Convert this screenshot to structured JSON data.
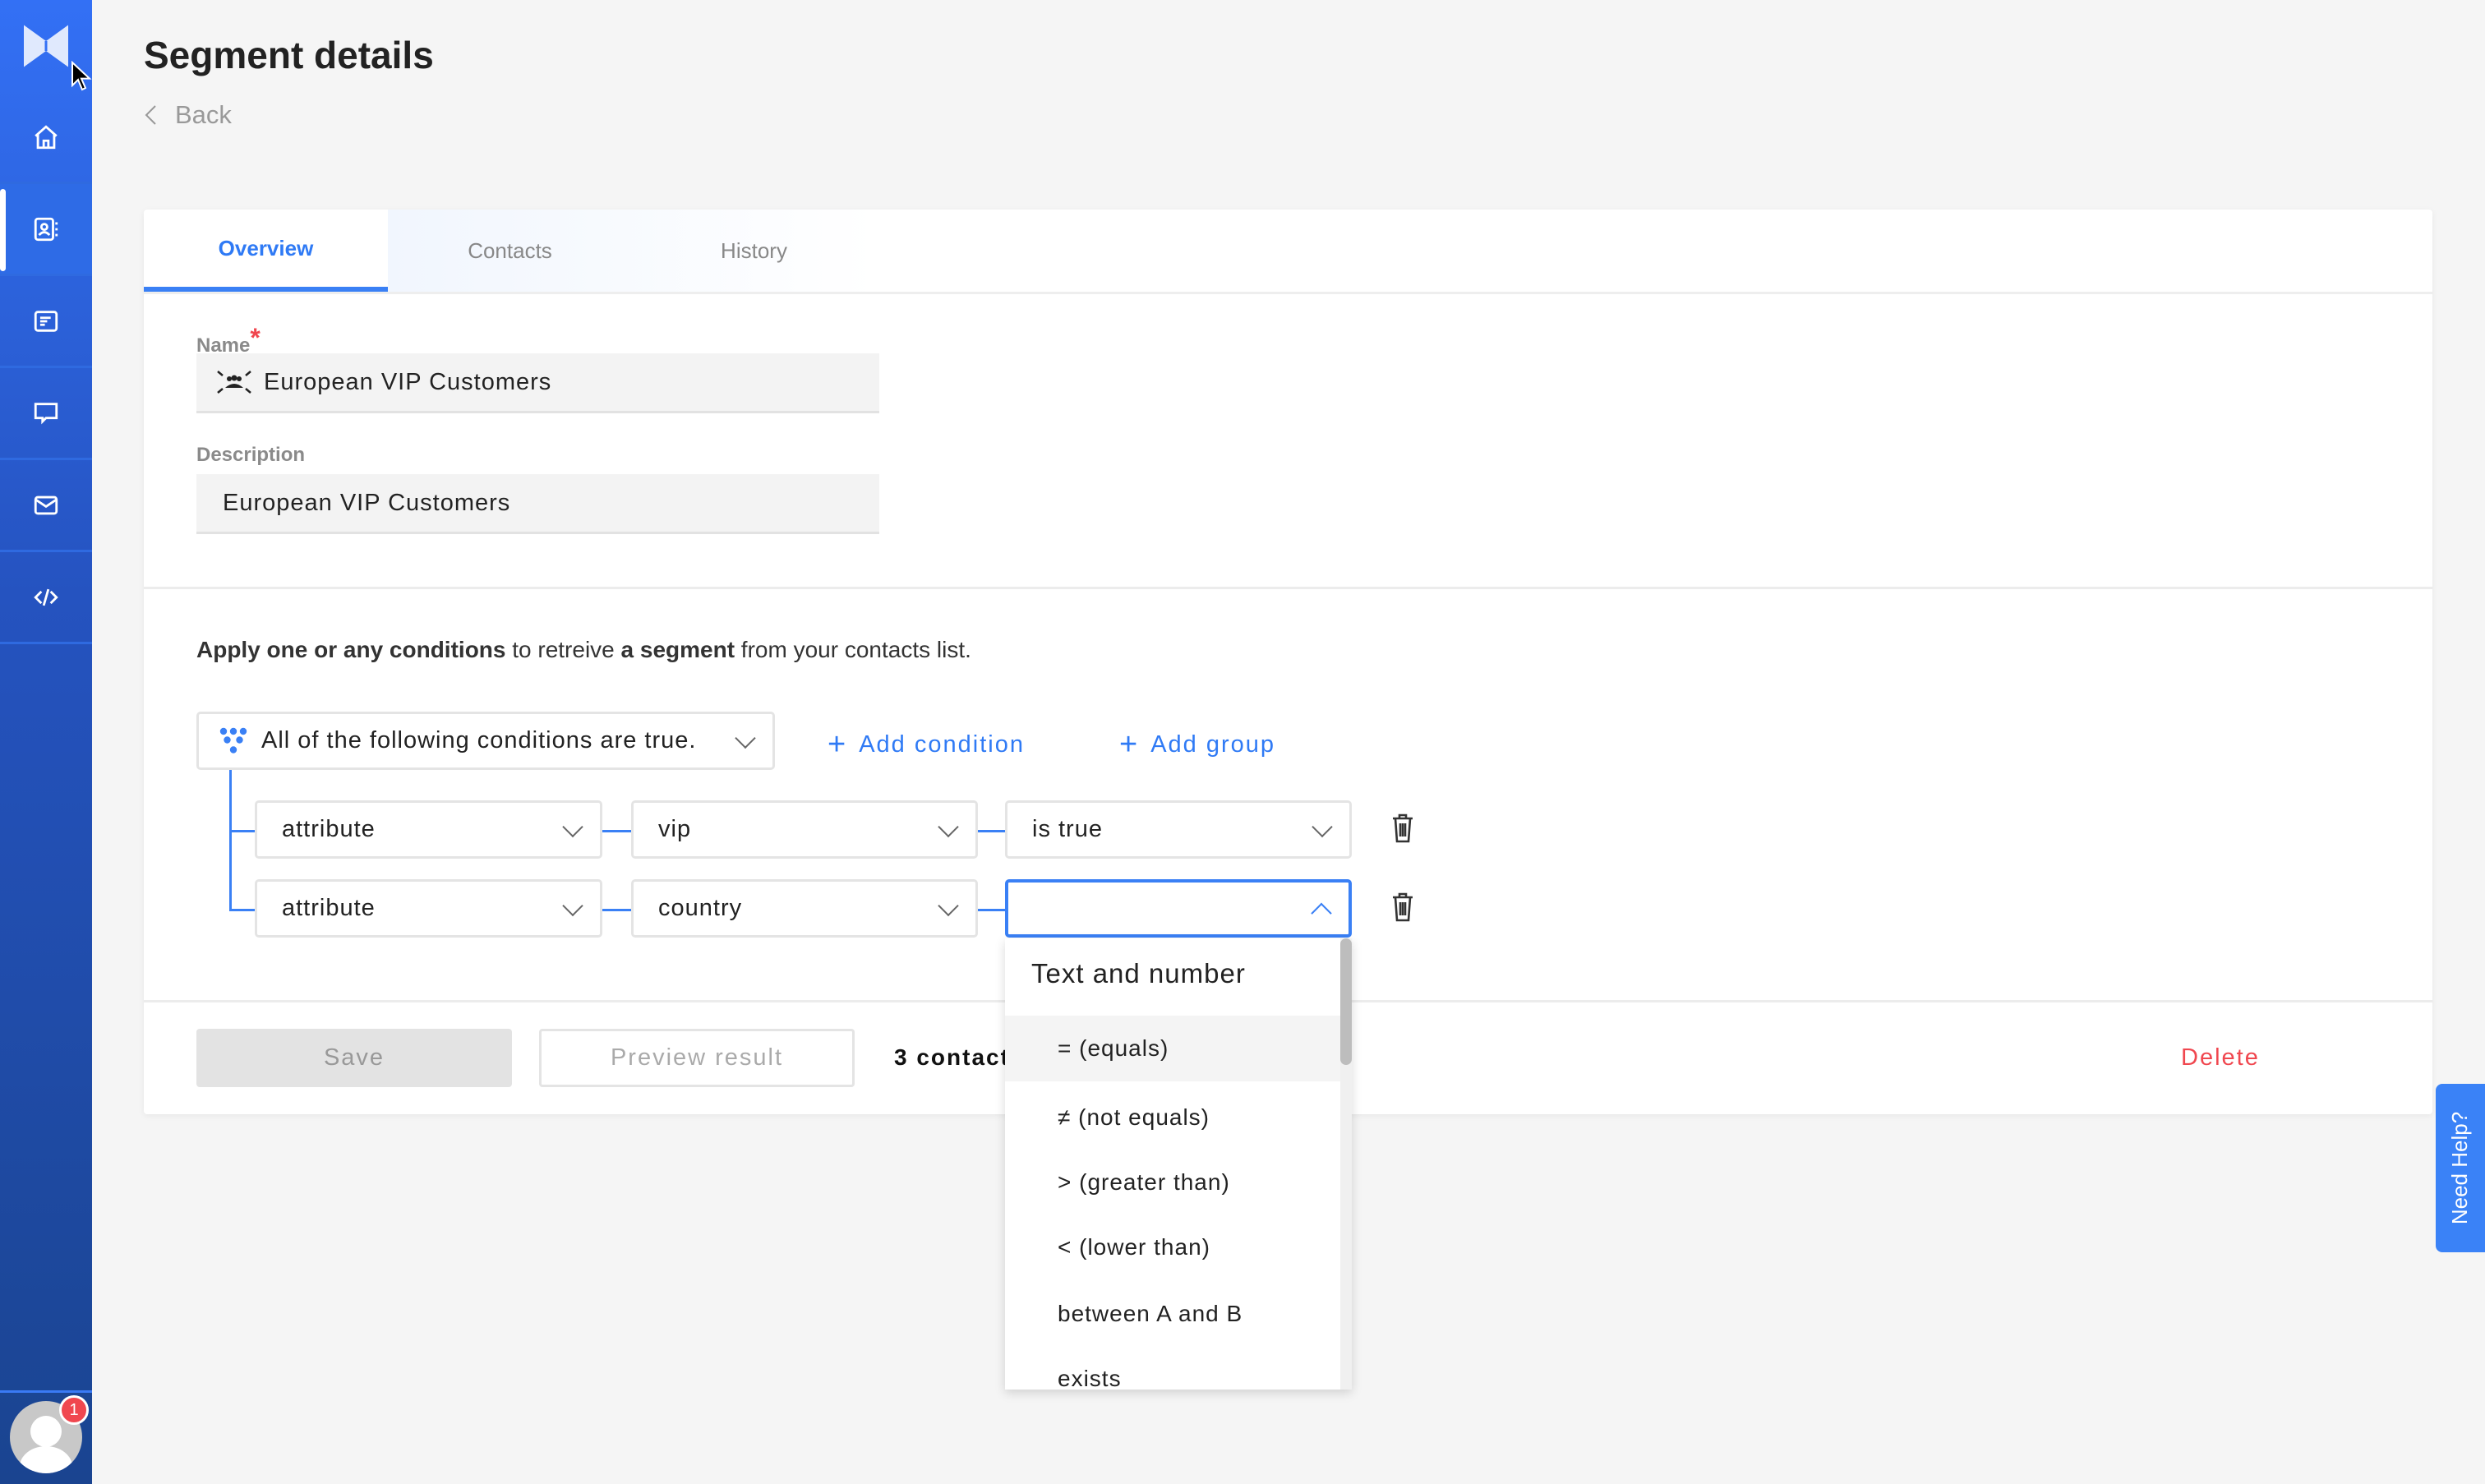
{
  "colors": {
    "accent": "#3a80f5",
    "sidebar": "#2553c0",
    "danger": "#f0474f"
  },
  "sidebar": {
    "items": [
      {
        "icon": "home-icon"
      },
      {
        "icon": "contacts-icon",
        "active": true
      },
      {
        "icon": "list-icon"
      },
      {
        "icon": "chat-icon"
      },
      {
        "icon": "mail-icon"
      },
      {
        "icon": "code-icon"
      }
    ],
    "notification_count": "1"
  },
  "header": {
    "title": "Segment details",
    "back_label": "Back"
  },
  "tabs": [
    {
      "label": "Overview",
      "active": true
    },
    {
      "label": "Contacts"
    },
    {
      "label": "History"
    }
  ],
  "form": {
    "name_label": "Name",
    "required_mark": "*",
    "name_value": "European VIP Customers",
    "description_label": "Description",
    "description_value": "European VIP Customers"
  },
  "conditions": {
    "intro_bold1": "Apply one or any conditions",
    "intro_mid": " to retreive ",
    "intro_bold2": "a segment",
    "intro_end": " from your contacts list.",
    "group_mode": "All of the following conditions are true.",
    "add_condition": "Add condition",
    "add_group": "Add group",
    "rows": [
      {
        "type": "attribute",
        "field": "vip",
        "operator": "is true"
      },
      {
        "type": "attribute",
        "field": "country",
        "operator": ""
      }
    ]
  },
  "operator_dropdown": {
    "header": "Text and number",
    "options": [
      "= (equals)",
      "≠ (not equals)",
      "> (greater than)",
      "< (lower than)",
      "between A and B",
      "exists"
    ],
    "highlighted": 0
  },
  "footer": {
    "save": "Save",
    "preview": "Preview result",
    "contacts_count": "3 contacts",
    "delete": "Delete"
  },
  "help": {
    "label": "Need Help?"
  }
}
